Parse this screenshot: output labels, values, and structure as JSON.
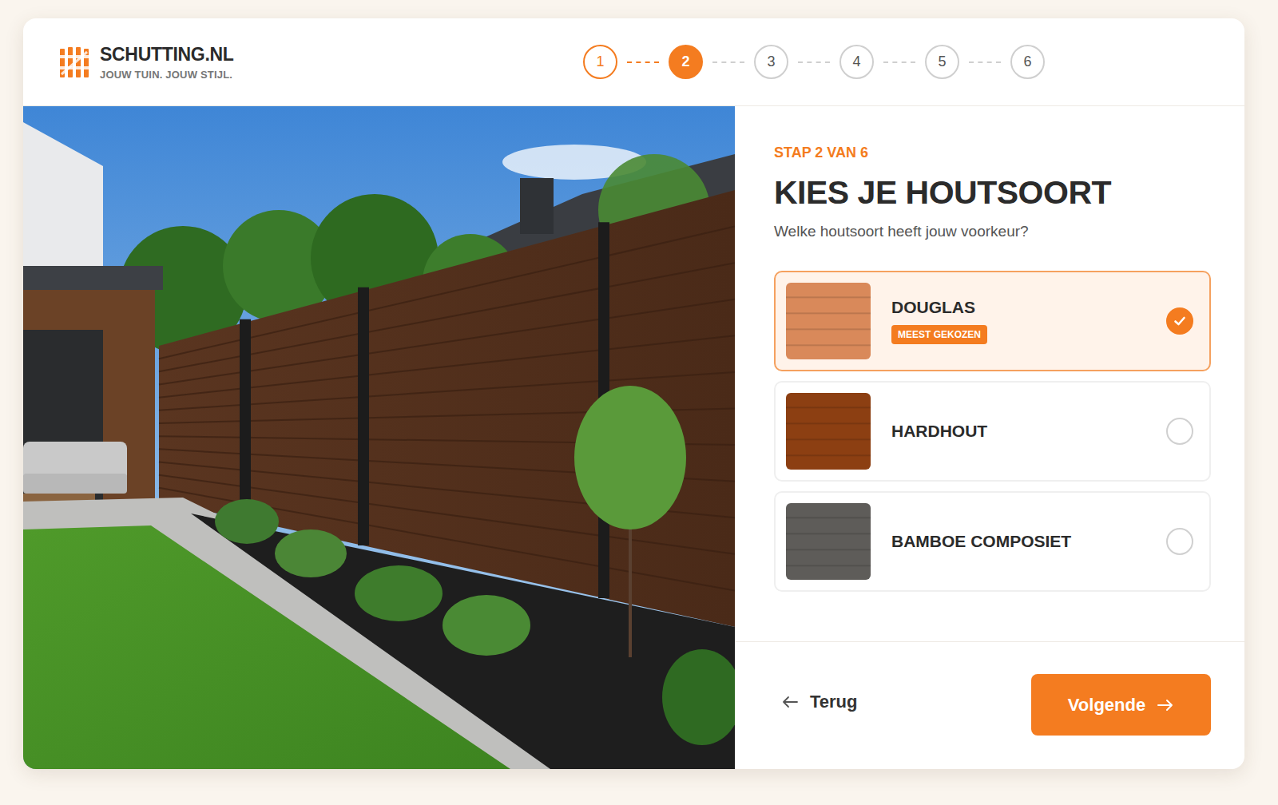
{
  "brand": {
    "name": "SCHUTTING.NL",
    "tagline": "JOUW TUIN. JOUW STIJL."
  },
  "steps": [
    {
      "label": "1",
      "done": true,
      "selected": false
    },
    {
      "label": "2",
      "done": false,
      "selected": true
    },
    {
      "label": "3",
      "done": false,
      "selected": false
    },
    {
      "label": "4",
      "done": false,
      "selected": false
    },
    {
      "label": "5",
      "done": false,
      "selected": false
    },
    {
      "label": "6",
      "done": false,
      "selected": false
    }
  ],
  "step_label": "STAP 2 VAN 6",
  "title": "KIES JE HOUTSOORT",
  "subtitle": "Welke houtsoort heeft jouw voorkeur?",
  "options": [
    {
      "name": "DOUGLAS",
      "badge": "MEEST GEKOZEN",
      "selected": true,
      "color": "#d9895a"
    },
    {
      "name": "HARDHOUT",
      "selected": false,
      "color": "#8c3f12"
    },
    {
      "name": "BAMBOE COMPOSIET",
      "selected": false,
      "color": "#5e5c59"
    }
  ],
  "back": {
    "label": "Terug"
  },
  "next": {
    "label": "Volgende"
  }
}
